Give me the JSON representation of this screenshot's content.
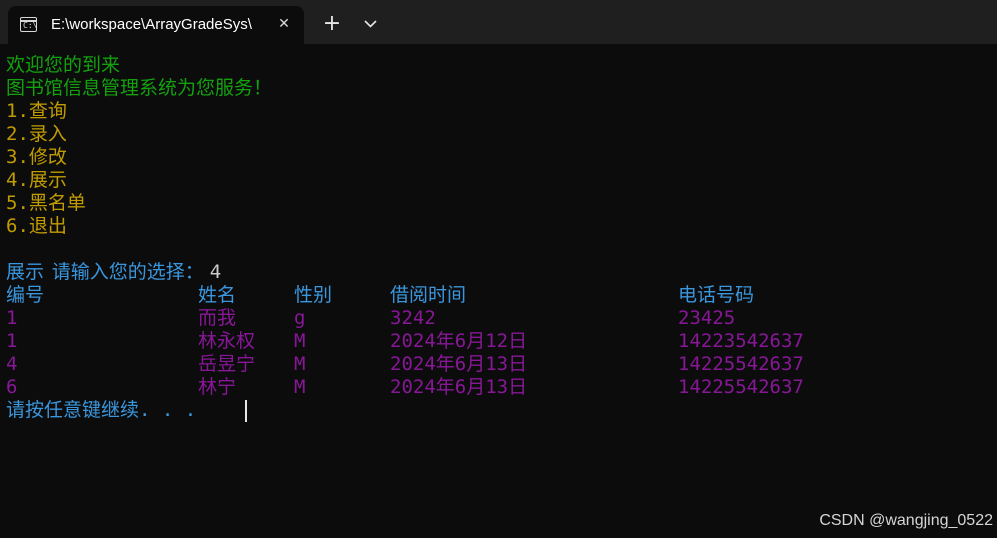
{
  "tab": {
    "icon": "terminal-icon",
    "icon_glyph": "C:\\",
    "title": "E:\\workspace\\ArrayGradeSys\\",
    "close_glyph": "✕",
    "new_tab_glyph": "+"
  },
  "console": {
    "welcome": "欢迎您的到来",
    "service": "图书馆信息管理系统为您服务！",
    "menu": [
      "1.查询",
      "2.录入",
      "3.修改",
      "4.展示",
      "5.黑名单",
      "6.退出"
    ],
    "prompt": "请输入您的选择：",
    "input_value": "4",
    "section_title": "展示",
    "table": {
      "headers": [
        "编号",
        "姓名",
        "性别",
        "借阅时间",
        "电话号码"
      ],
      "rows": [
        [
          "1",
          "而我",
          "g",
          "3242",
          "23425"
        ],
        [
          "1",
          "林永权",
          "M",
          "2024年6月12日",
          "14223542637"
        ],
        [
          "4",
          "岳昱宁",
          "M",
          "2024年6月13日",
          "14225542637"
        ],
        [
          "6",
          "林宁",
          "M",
          "2024年6月13日",
          "14225542637"
        ]
      ]
    },
    "continue_prompt": "请按任意键继续. . ."
  },
  "watermark": "CSDN @wangjing_0522",
  "colors": {
    "background": "#0c0c0c",
    "green": "#13a10e",
    "yellow": "#c19c00",
    "blue": "#3a96dd",
    "purple": "#881798"
  }
}
